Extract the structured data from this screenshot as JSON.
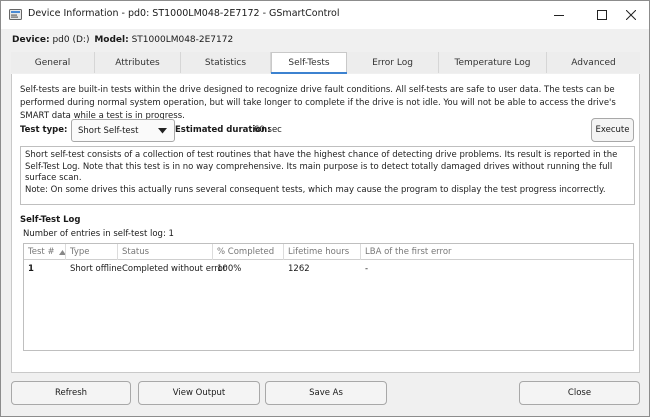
{
  "window": {
    "title": "Device Information - pd0: ST1000LM048-2E7172 - GSmartControl"
  },
  "device": {
    "device_label": "Device:",
    "device_value": "pd0 (D:)",
    "model_label": "Model:",
    "model_value": "ST1000LM048-2E7172"
  },
  "tabs": [
    {
      "label": "General"
    },
    {
      "label": "Attributes"
    },
    {
      "label": "Statistics"
    },
    {
      "label": "Self-Tests"
    },
    {
      "label": "Error Log"
    },
    {
      "label": "Temperature Log"
    },
    {
      "label": "Advanced"
    }
  ],
  "selftests": {
    "intro": "Self-tests are built-in tests within the drive designed to recognize drive fault conditions. All self-tests are safe to user data. The tests can be performed during normal system operation, but will take longer to complete if the drive is not idle. You will not be able to access the drive's SMART data while a test is in progress.",
    "test_type_label": "Test type:",
    "test_type_value": "Short Self-test",
    "estimated_label": "Estimated duration:",
    "estimated_value": "60 sec",
    "execute_label": "Execute",
    "description_line1": "Short self-test consists of a collection of test routines that have the highest chance of detecting drive problems. Its result is reported in the Self-Test Log. Note that this test is in no way comprehensive. Its main purpose is to detect totally damaged drives without running the full surface scan.",
    "description_line2": "Note: On some drives this actually runs several consequent tests, which may cause the program to display the test progress incorrectly.",
    "log_title": "Self-Test Log",
    "entries_text": "Number of entries in self-test log: 1"
  },
  "log_table": {
    "columns": [
      "Test #",
      "Type",
      "Status",
      "% Completed",
      "Lifetime hours",
      "LBA of the first error"
    ],
    "rows": [
      [
        "1",
        "Short offline",
        "Completed without error",
        "100%",
        "1262",
        "-"
      ]
    ]
  },
  "footer": {
    "refresh": "Refresh",
    "view_output": "View Output",
    "save_as": "Save As",
    "close": "Close"
  }
}
